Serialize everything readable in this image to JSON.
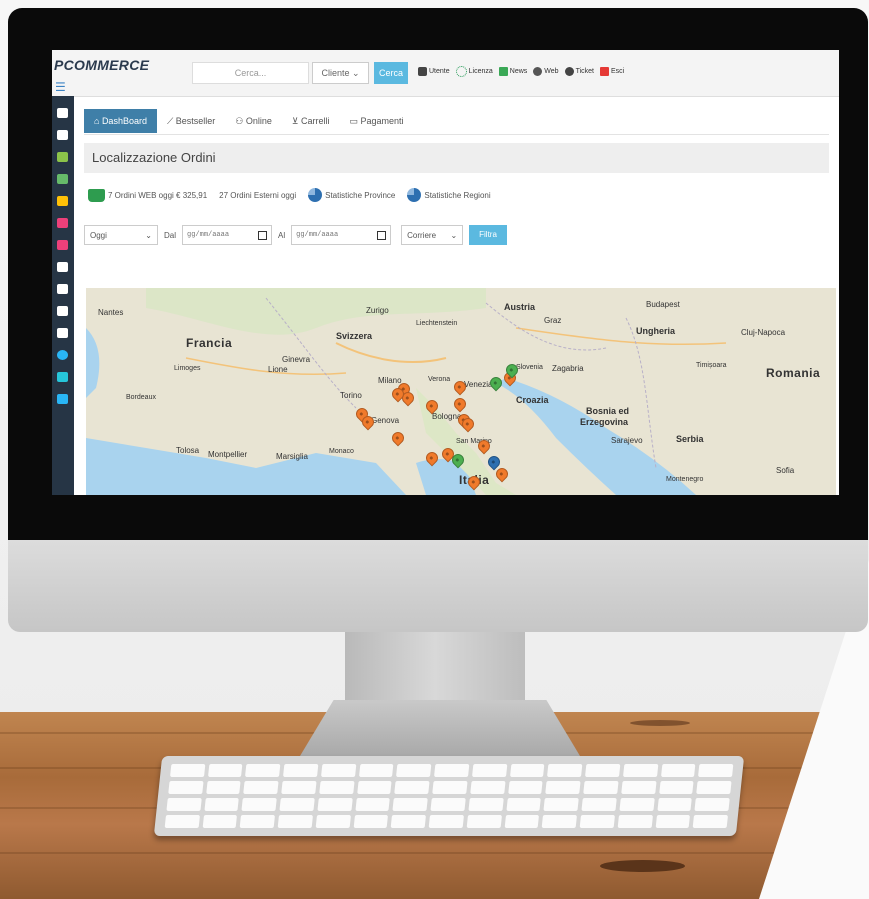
{
  "topbar": {
    "logo": "PCOMMERCE",
    "search_placeholder": "Cerca...",
    "client_select": "Cliente",
    "search_button": "Cerca",
    "links": [
      "Utente",
      "Licenza",
      "News",
      "Web",
      "Ticket",
      "Esci"
    ]
  },
  "tabs": [
    {
      "label": "DashBoard",
      "active": true
    },
    {
      "label": "Bestseller"
    },
    {
      "label": "Online"
    },
    {
      "label": "Carrelli"
    },
    {
      "label": "Pagamenti"
    }
  ],
  "page_title": "Localizzazione Ordini",
  "stats": {
    "web_orders": "7 Ordini WEB oggi € 325,91",
    "external_orders": "27 Ordini Esterni oggi",
    "province_stats": "Statistiche Province",
    "region_stats": "Statistiche Regioni"
  },
  "filters": {
    "period": "Oggi",
    "from_label": "Dal",
    "to_label": "Al",
    "date_placeholder": "gg/mm/aaaa",
    "courier": "Corriere",
    "filter_button": "Filtra"
  },
  "map": {
    "labels": {
      "nantes": "Nantes",
      "francia": "Francia",
      "svizzera": "Svizzera",
      "zurigo": "Zurigo",
      "liechtenstein": "Liechtenstein",
      "austria": "Austria",
      "graz": "Graz",
      "budapest": "Budapest",
      "ungheria": "Ungheria",
      "cluj": "Cluj-Napoca",
      "romania": "Romania",
      "lione": "Lione",
      "ginevra": "Ginevra",
      "limoges": "Limoges",
      "bordeaux": "Bordeaux",
      "torino": "Torino",
      "milano": "Milano",
      "verona": "Verona",
      "venezia": "Venezia",
      "slovenia": "Slovenia",
      "zagabria": "Zagabria",
      "genova": "Genova",
      "bologna": "Bologna",
      "croazia": "Croazia",
      "bosnia": "Bosnia ed",
      "erzegovina": "Erzegovina",
      "sarajevo": "Sarajevo",
      "serbia": "Serbia",
      "tolosa": "Tolosa",
      "montpellier": "Montpellier",
      "marsiglia": "Marsiglia",
      "monaco": "Monaco",
      "san_marino": "San Marino",
      "italia": "Italia",
      "montenegro": "Montenegro",
      "sofia": "Sofia",
      "timisoara": "Timișoara"
    },
    "pin_colors": {
      "orange": "#f07a2b",
      "green": "#4caf50",
      "blue": "#2d6fb0"
    }
  }
}
